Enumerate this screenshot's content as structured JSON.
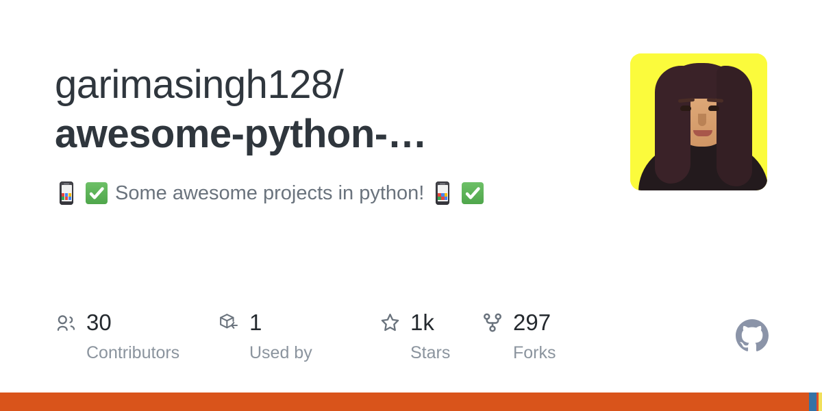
{
  "card": {
    "background": "#ffffff"
  },
  "repo": {
    "owner": "garimasingh128/",
    "name": "awesome-python-…",
    "full_name": "garimasingh128/awesome-python-…",
    "title_color": "#2f363d"
  },
  "description": {
    "leading_emoji": [
      "mobile-phone",
      "white-check-mark"
    ],
    "text": "Some awesome projects in python!",
    "trailing_emoji": [
      "mobile-phone",
      "white-check-mark"
    ],
    "full_text": "📱 ✅ Some awesome projects in python! 📱 ✅",
    "color": "#6a737d"
  },
  "avatar": {
    "alt": "owner avatar",
    "background_color": "#fbfb3c"
  },
  "stats": [
    {
      "icon": "people-icon",
      "value": "30",
      "label": "Contributors"
    },
    {
      "icon": "package-icon",
      "value": "1",
      "label": "Used by"
    },
    {
      "icon": "star-icon",
      "value": "1k",
      "label": "Stars"
    },
    {
      "icon": "fork-icon",
      "value": "297",
      "label": "Forks"
    }
  ],
  "github_mark": {
    "icon": "github-octocat-icon",
    "color": "#8b94a8"
  },
  "language_bar": {
    "segments": [
      {
        "name": "primary",
        "color": "#d9541b",
        "width_pct": 98.42
      },
      {
        "name": "secondary",
        "color": "#3572a5",
        "width_pct": 0.92
      },
      {
        "name": "tertiary",
        "color": "#e34c26",
        "width_pct": 0.25
      },
      {
        "name": "quaternary",
        "color": "#f1e05a",
        "width_pct": 0.41
      }
    ]
  }
}
